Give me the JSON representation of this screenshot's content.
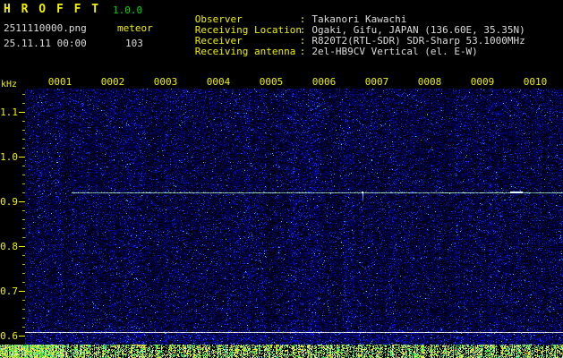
{
  "app": {
    "title": "H R O F F T",
    "version": "1.0.0",
    "filename": "2511110000.png",
    "mode": "meteor",
    "datetime": "25.11.11 00:00",
    "count": "103"
  },
  "observer_info": {
    "separator": ":",
    "rows": [
      {
        "label": "Observer",
        "value": "Takanori Kawachi"
      },
      {
        "label": "Receiving Location",
        "value": "Ogaki, Gifu, JAPAN (136.60E, 35.35N)"
      },
      {
        "label": "Receiver",
        "value": "R820T2(RTL-SDR) SDR-Sharp 53.1000MHz"
      },
      {
        "label": "Receiving antenna",
        "value": "2el-HB9CV Vertical (el. E-W)"
      }
    ]
  },
  "chart_data": {
    "type": "heatmap",
    "title": "HROFFT radio meteor observation spectrogram, 10 minute window",
    "ylabel": "kHz",
    "xlabel": "",
    "grid": false,
    "legend": false,
    "x_tick_labels": [
      "0001",
      "0002",
      "0003",
      "0004",
      "0005",
      "0006",
      "0007",
      "0008",
      "0009",
      "0010"
    ],
    "x_range_min": [
      0,
      10
    ],
    "y_tick_labels": [
      "1.1",
      "1.0",
      "0.9",
      "0.8",
      "0.7",
      "0.6"
    ],
    "y_tick_khz": [
      1.1,
      1.0,
      0.9,
      0.8,
      0.7,
      0.6
    ],
    "y_range_khz": [
      0.58,
      1.15
    ],
    "carrier_line": {
      "freq_khz": 0.92,
      "start_frac": 0.086,
      "events": [
        {
          "frac": 0.627,
          "type": "downward-spike"
        },
        {
          "frac": 0.902,
          "type": "bright-segment"
        }
      ]
    },
    "baseline_khz": 0.608,
    "colors": {
      "background": "#000000",
      "noise_low": "#000040",
      "noise_mid": "#0030a0",
      "noise_high": "#00c8ff",
      "carrier": "#bfffe8",
      "baseline": "#d0d0d8",
      "band_yellow": "#f0f000",
      "band_green": "#30d040",
      "axis_text": "#f0f000",
      "axis_text_dim": "#b9b900"
    }
  }
}
